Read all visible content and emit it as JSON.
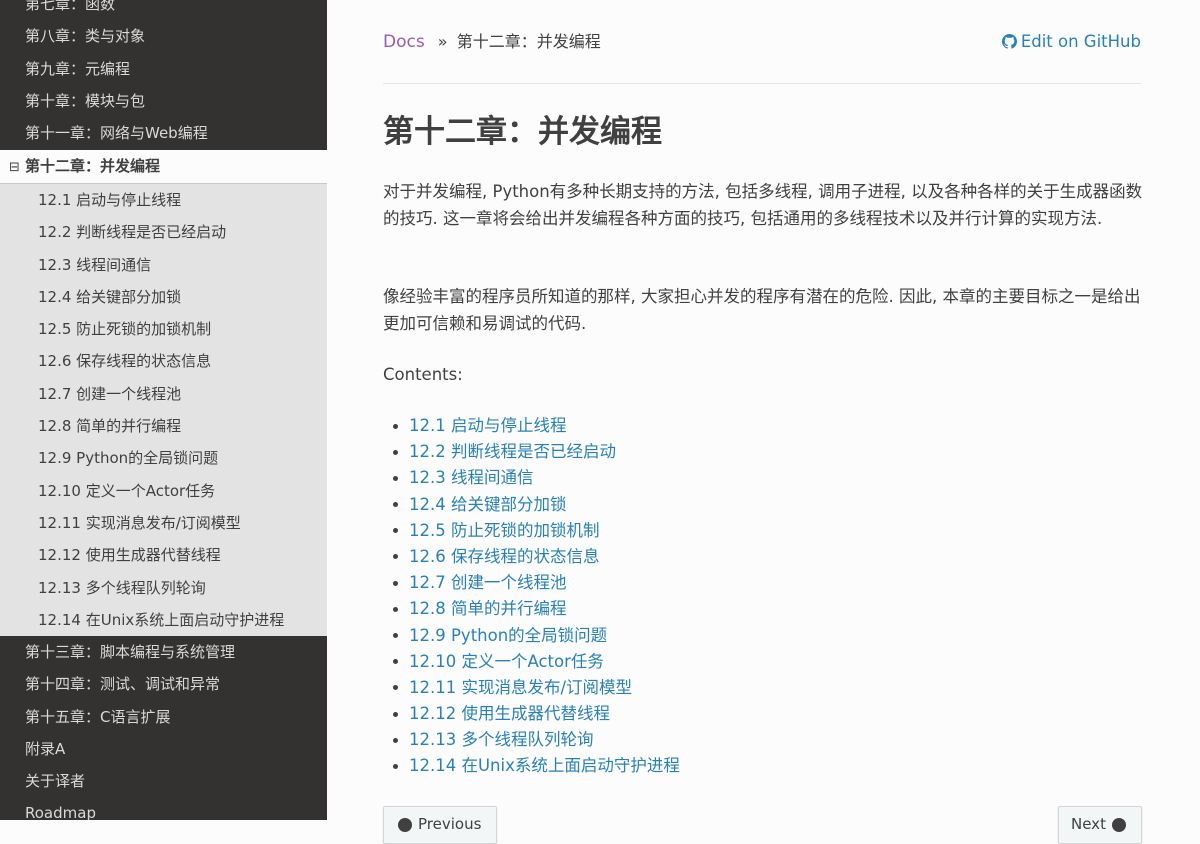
{
  "sidebar": {
    "top_items": [
      "第七章：函数",
      "第八章：类与对象",
      "第九章：元编程",
      "第十章：模块与包",
      "第十一章：网络与Web编程"
    ],
    "current": {
      "toggle": "⊟",
      "label": "第十二章：并发编程",
      "subitems": [
        "12.1 启动与停止线程",
        "12.2 判断线程是否已经启动",
        "12.3 线程间通信",
        "12.4 给关键部分加锁",
        "12.5 防止死锁的加锁机制",
        "12.6 保存线程的状态信息",
        "12.7 创建一个线程池",
        "12.8 简单的并行编程",
        "12.9 Python的全局锁问题",
        "12.10 定义一个Actor任务",
        "12.11 实现消息发布/订阅模型",
        "12.12 使用生成器代替线程",
        "12.13 多个线程队列轮询",
        "12.14 在Unix系统上面启动守护进程"
      ]
    },
    "bottom_items": [
      "第十三章：脚本编程与系统管理",
      "第十四章：测试、调试和异常",
      "第十五章：C语言扩展",
      "附录A",
      "关于译者",
      "Roadmap"
    ]
  },
  "breadcrumbs": {
    "docs": "Docs",
    "separator": "»",
    "current": "第十二章：并发编程",
    "edit_link": "Edit on GitHub"
  },
  "main": {
    "title": "第十二章：并发编程",
    "paragraphs": [
      "对于并发编程, Python有多种长期支持的方法, 包括多线程, 调用子进程, 以及各种各样的关于生成器函数的技巧. 这一章将会给出并发编程各种方面的技巧, 包括通用的多线程技术以及并行计算的实现方法.",
      "像经验丰富的程序员所知道的那样, 大家担心并发的程序有潜在的危险. 因此, 本章的主要目标之一是给出更加可信赖和易调试的代码."
    ],
    "contents_label": "Contents:",
    "toc": [
      "12.1 启动与停止线程",
      "12.2 判断线程是否已经启动",
      "12.3 线程间通信",
      "12.4 给关键部分加锁",
      "12.5 防止死锁的加锁机制",
      "12.6 保存线程的状态信息",
      "12.7 创建一个线程池",
      "12.8 简单的并行编程",
      "12.9 Python的全局锁问题",
      "12.10 定义一个Actor任务",
      "12.11 实现消息发布/订阅模型",
      "12.12 使用生成器代替线程",
      "12.13 多个线程队列轮询",
      "12.14 在Unix系统上面启动守护进程"
    ],
    "prev_label": "Previous",
    "next_label": "Next"
  },
  "colors": {
    "sidebar_bg": "#343131",
    "link": "#2980b9",
    "docs_link": "#9b59b6",
    "text": "#404040"
  }
}
